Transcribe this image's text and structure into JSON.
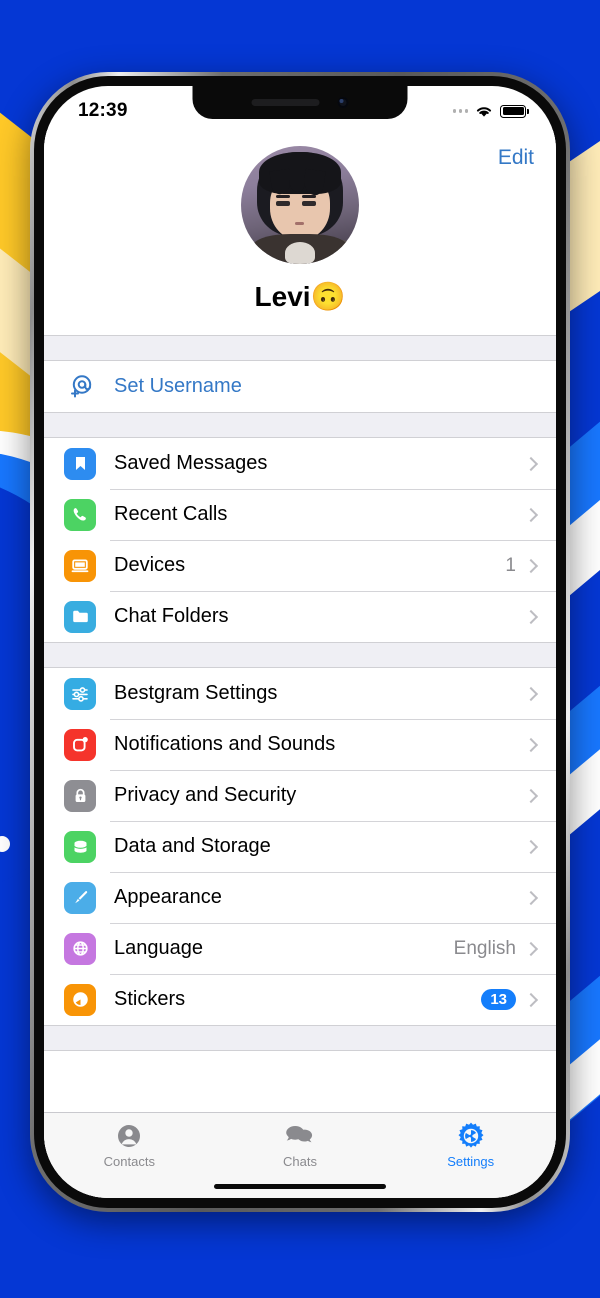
{
  "background": {
    "base_color": "#0537D4",
    "accent_yellow": "#FFC928",
    "accent_cream": "#FFECB8",
    "accent_light_blue": "#1877FF"
  },
  "status_bar": {
    "time": "12:39",
    "cellular_icon": "cellular-dots-icon",
    "wifi_icon": "wifi-icon",
    "battery_icon": "battery-full-icon"
  },
  "header": {
    "edit_label": "Edit"
  },
  "profile": {
    "name": "Levi🙃",
    "avatar_icon": "user-avatar"
  },
  "username_section": {
    "icon": "at-sign-add-icon",
    "label": "Set Username"
  },
  "sections": [
    {
      "rows": [
        {
          "label": "Saved Messages",
          "icon": "bookmark-icon",
          "color": "#2D8CF0",
          "value": "",
          "badge": ""
        },
        {
          "label": "Recent Calls",
          "icon": "phone-icon",
          "color": "#4CD363",
          "value": "",
          "badge": ""
        },
        {
          "label": "Devices",
          "icon": "laptop-icon",
          "color": "#F89406",
          "value": "1",
          "badge": ""
        },
        {
          "label": "Chat Folders",
          "icon": "folder-icon",
          "color": "#39ADE0",
          "value": "",
          "badge": ""
        }
      ]
    },
    {
      "rows": [
        {
          "label": "Bestgram Settings",
          "icon": "sliders-icon",
          "color": "#35ACE3",
          "value": "",
          "badge": ""
        },
        {
          "label": "Notifications and Sounds",
          "icon": "notification-icon",
          "color": "#F5342B",
          "value": "",
          "badge": ""
        },
        {
          "label": "Privacy and Security",
          "icon": "lock-icon",
          "color": "#8E8E93",
          "value": "",
          "badge": ""
        },
        {
          "label": "Data and Storage",
          "icon": "database-icon",
          "color": "#4CD363",
          "value": "",
          "badge": ""
        },
        {
          "label": "Appearance",
          "icon": "paintbrush-icon",
          "color": "#4BADE8",
          "value": "",
          "badge": ""
        },
        {
          "label": "Language",
          "icon": "globe-icon",
          "color": "#C577E0",
          "value": "English",
          "badge": ""
        },
        {
          "label": "Stickers",
          "icon": "sticker-icon",
          "color": "#F89406",
          "value": "",
          "badge": "13"
        }
      ]
    }
  ],
  "tab_bar": {
    "tabs": [
      {
        "label": "Contacts",
        "icon": "contacts-person-icon",
        "active": false
      },
      {
        "label": "Chats",
        "icon": "chat-bubbles-icon",
        "active": false
      },
      {
        "label": "Settings",
        "icon": "gear-icon",
        "active": true
      }
    ],
    "active_color": "#147EFB",
    "inactive_color": "#8A8A8E"
  }
}
